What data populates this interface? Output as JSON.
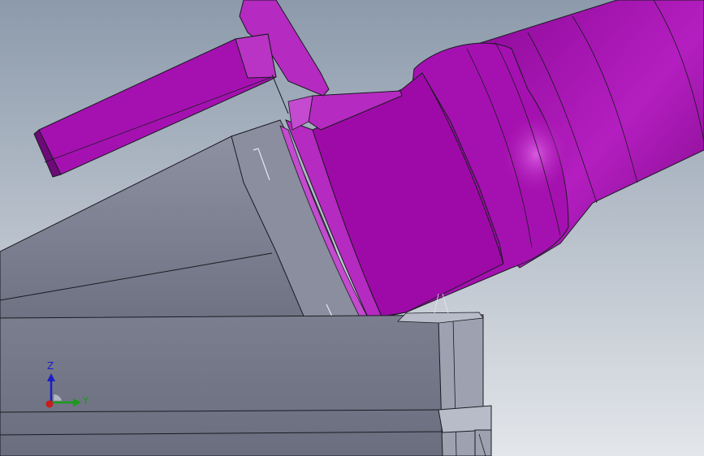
{
  "viewport": {
    "colors": {
      "background_top": "#8c9aab",
      "background_bottom": "#e3e6ea",
      "magenta_part": "#a10aab",
      "magenta_dark": "#6d0a78",
      "magenta_light": "#c13ccc",
      "gray_part": "#7b7f8f",
      "gray_dark": "#5d616f",
      "gray_light": "#9ea2b0",
      "edge": "#1a1a22"
    }
  },
  "triad": {
    "z_label": "Z",
    "y_label": "Y",
    "colors": {
      "z_axis": "#1d1dc8",
      "y_axis": "#1a9a1a",
      "x_axis": "#c81d1d"
    }
  }
}
